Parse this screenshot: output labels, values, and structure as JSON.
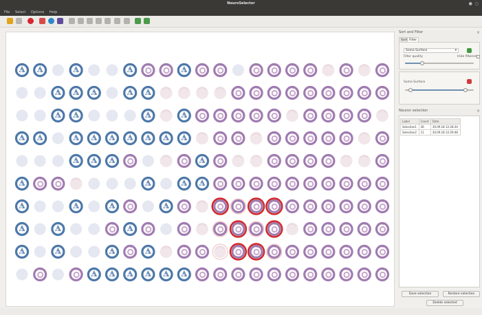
{
  "window": {
    "title": "NeuroSelector",
    "controls": "● ○"
  },
  "menu": {
    "items": [
      "File",
      "Select",
      "Options",
      "Help"
    ]
  },
  "toolbar": {
    "buttons": [
      {
        "icon": "open-folder-icon",
        "color": "#e0a31a"
      },
      {
        "icon": "save-icon",
        "color": "#b8b6b2"
      },
      {
        "icon": "record-icon",
        "color": "#d7262e"
      },
      {
        "icon": "selection-icon",
        "color": "#d74a4a"
      },
      {
        "icon": "target-icon",
        "color": "#2e88c8"
      },
      {
        "icon": "camera-icon",
        "color": "#5f4c9a"
      },
      {
        "icon": "pointer-icon",
        "color": "#b4b2ad"
      },
      {
        "icon": "grid-1-icon",
        "color": "#b4b2ad"
      },
      {
        "icon": "grid-2-icon",
        "color": "#b4b2ad"
      },
      {
        "icon": "grid-3-icon",
        "color": "#b4b2ad"
      },
      {
        "icon": "grid-4-icon",
        "color": "#b4b2ad"
      },
      {
        "icon": "line-icon",
        "color": "#b4b2ad"
      },
      {
        "icon": "zoom-icon",
        "color": "#b4b2ad"
      },
      {
        "icon": "settings-icon",
        "color": "#4c9a4c"
      },
      {
        "icon": "export-icon",
        "color": "#4c9a4c"
      }
    ]
  },
  "sort_and_filter": {
    "title": "Sort and Filter",
    "tabs": [
      "Sort",
      "Filter"
    ],
    "active_tab": "Filter",
    "filter_combo": "Soma Surface",
    "filter_quality_label": "Filter quality",
    "hide_filtered_label": "Hide filtered",
    "quality_level": 0.25,
    "range_label": "Soma Surface",
    "range_low": 0.08,
    "range_high": 0.88
  },
  "neuron_selection": {
    "title": "Neuron selection",
    "columns": [
      "Label",
      "Count",
      "Date"
    ],
    "rows": [
      [
        "Selection1",
        "36",
        "30.09.18 12:28:34"
      ],
      [
        "Selection2",
        "11",
        "30.09.18 12:29:48"
      ]
    ],
    "buttons": {
      "save": "Save selection",
      "restore": "Restore selection",
      "delete": "Delete selected"
    }
  },
  "grid": {
    "columns": 21,
    "rows": 10,
    "cells": [
      "BBLBLLBPPBPPLPPPPFPFP",
      "LLBBBLBBFFFFPPPPPPPPP",
      "LLBBLLLBFBPPPPPFPPPPF",
      "BBLBBBBBBBFPPFPPPPPFP",
      "LLLBBBPLFPBPFFPPPPFFP",
      "BPPFLLLBLBBPPPPPPPPPP",
      "BLLBLBPLBPFPPPPPPPPPP",
      "BLBLLPBPLPFPPPPFPPPPP",
      "BLBLLBPBFPPFPPPPPPPPP",
      "LPLPBBBBBBPPPPPPPPPPP"
    ],
    "selected": [
      [
        6,
        11
      ],
      [
        6,
        13
      ],
      [
        6,
        14
      ],
      [
        7,
        12
      ],
      [
        7,
        14
      ],
      [
        8,
        12
      ],
      [
        8,
        13
      ]
    ],
    "faint_rings": [
      [
        6,
        12
      ],
      [
        7,
        11
      ],
      [
        7,
        13
      ],
      [
        8,
        11
      ],
      [
        8,
        14
      ]
    ],
    "colors": {
      "blue": "#4d78a8",
      "blue_inner": "#6d8fb8",
      "purple": "#a07bb0",
      "purple_inner": "#c7a6cc",
      "light": "#e5e7f1",
      "faint": "#f1e6ea",
      "selection": "#d32626"
    }
  }
}
